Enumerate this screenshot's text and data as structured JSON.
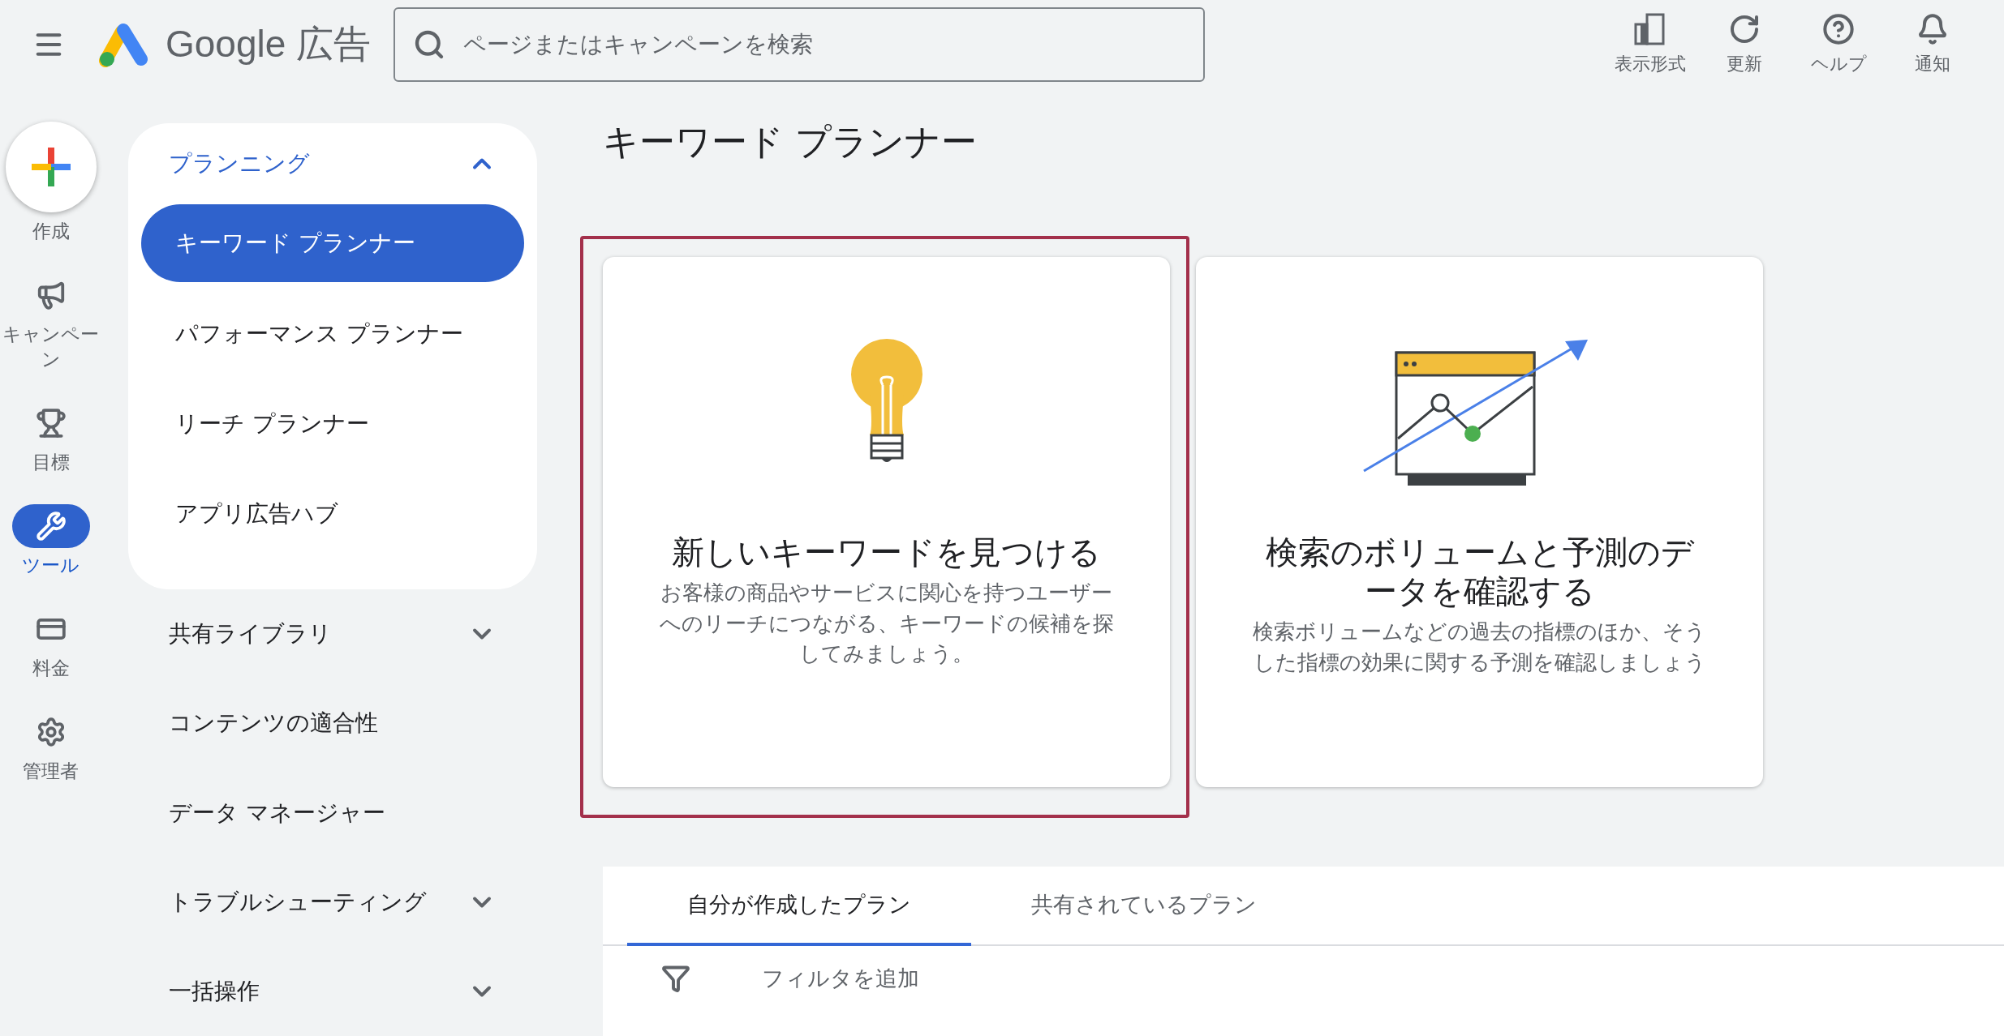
{
  "header": {
    "logo_text": "Google",
    "product": "広告",
    "search": {
      "placeholder": "ページまたはキャンペーンを検索"
    },
    "actions": [
      {
        "label": "表示形式",
        "kind": "appearance"
      },
      {
        "label": "更新",
        "kind": "refresh"
      },
      {
        "label": "ヘルプ",
        "kind": "help"
      },
      {
        "label": "通知",
        "kind": "bell"
      }
    ]
  },
  "create": {
    "label": "作成"
  },
  "rail": [
    {
      "label": "キャンペーン",
      "kind": "campaign",
      "selected": false
    },
    {
      "label": "目標",
      "kind": "goal",
      "selected": false
    },
    {
      "label": "ツール",
      "kind": "tools",
      "selected": true
    },
    {
      "label": "料金",
      "kind": "billing",
      "selected": false
    },
    {
      "label": "管理者",
      "kind": "admin",
      "selected": false
    }
  ],
  "nav": {
    "section": {
      "label": "プランニング",
      "expanded": true,
      "children": [
        {
          "label": "キーワード プランナー",
          "selected": true
        },
        {
          "label": "パフォーマンス プランナー",
          "selected": false
        },
        {
          "label": "リーチ プランナー",
          "selected": false
        },
        {
          "label": "アプリ広告ハブ",
          "selected": false
        }
      ]
    },
    "items": [
      {
        "label": "共有ライブラリ",
        "kind": "group",
        "expanded": false
      },
      {
        "label": "コンテンツの適合性",
        "kind": "link"
      },
      {
        "label": "データ マネージャー",
        "kind": "link"
      },
      {
        "label": "トラブルシューティング",
        "kind": "group",
        "expanded": false
      },
      {
        "label": "一括操作",
        "kind": "group",
        "expanded": false
      }
    ]
  },
  "page_title": "キーワード プランナー",
  "cards": [
    {
      "title": "新しいキーワードを見つける",
      "description": "お客様の商品やサービスに関心を持つユーザーへのリーチにつながる、キーワードの候補を探してみましょう。",
      "kind": "bulb",
      "highlighted": true
    },
    {
      "title": "検索のボリュームと予測のデータを確認する",
      "description": "検索ボリュームなどの過去の指標のほか、そうした指標の効果に関する予測を確認しましょう",
      "kind": "chart",
      "highlighted": false
    }
  ],
  "plans": {
    "tabs": [
      {
        "label": "自分が作成したプラン",
        "selected": true
      },
      {
        "label": "共有されているプラン",
        "selected": false
      }
    ],
    "filter": {
      "label": "フィルタを追加"
    }
  }
}
